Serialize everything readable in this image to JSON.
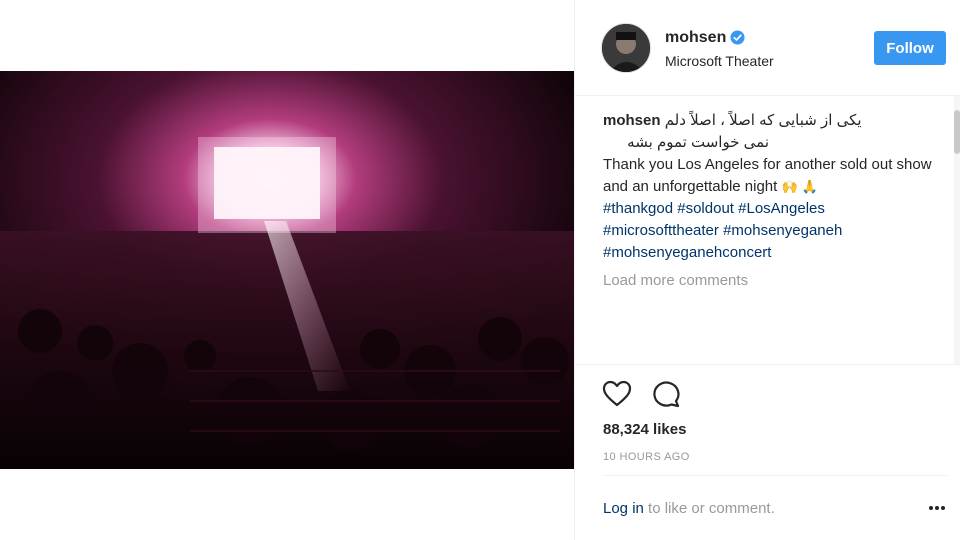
{
  "post": {
    "username": "mohsen",
    "location": "Microsoft Theater",
    "follow_label": "Follow",
    "caption_fa_line1": "یکی از شبایی که اصلاً ، اصلاً دلم",
    "caption_fa_line2": "نمی خواست تموم بشه",
    "caption_en": "Thank you Los Angeles for another sold out show and an unforgettable night",
    "caption_emojis": [
      "🙌",
      "🙏"
    ],
    "hashtags": [
      "#thankgod",
      "#soldout",
      "#LosAngeles",
      "#microsofttheater",
      "#mohsenyeganeh",
      "#mohsenyeganehconcert"
    ],
    "load_more_label": "Load more comments",
    "likes": "88,324 likes",
    "time_ago": "10 HOURS AGO",
    "login_link": "Log in",
    "login_suffix": " to like or comment."
  },
  "colors": {
    "follow_button": "#3897f0",
    "hashtag": "#003569",
    "muted_text": "#999999"
  },
  "icons": [
    "verified-badge-icon",
    "heart-icon",
    "comment-icon",
    "more-options-icon"
  ]
}
